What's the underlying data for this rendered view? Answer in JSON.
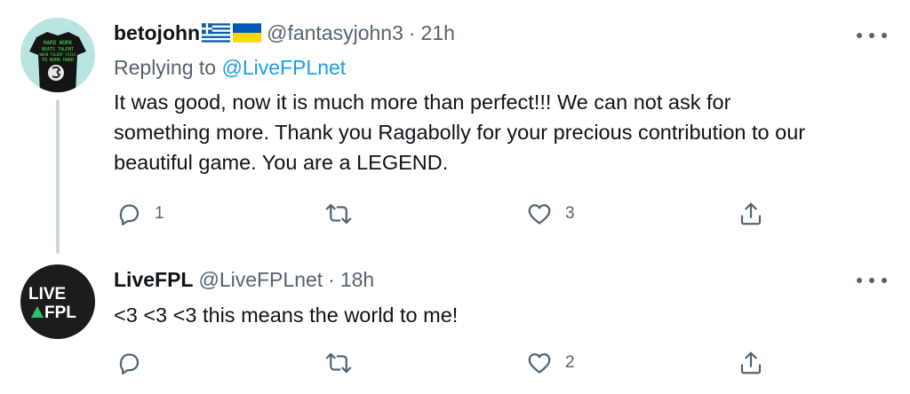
{
  "tweets": [
    {
      "display_name": "betojohn",
      "handle": "@fantasyjohn3",
      "separator": "·",
      "time": "21h",
      "replying_prefix": "Replying to",
      "replying_to": "@LiveFPLnet",
      "text_lines": [
        "It was good, now it is much more than perfect!!! We can not ask for",
        "something more. Thank you Ragabolly for your precious contribution to our",
        "beautiful game. You are a LEGEND."
      ],
      "counts": {
        "reply": "1",
        "retweet": "",
        "like": "3"
      },
      "avatar_shirt_text": [
        "HARD WORK",
        "BEATS TALENT",
        "WHEN TALENT FAILS",
        "TO WORK HARD"
      ],
      "flags": [
        "greece-flag",
        "ukraine-flag"
      ]
    },
    {
      "display_name": "LiveFPL",
      "handle": "@LiveFPLnet",
      "separator": "·",
      "time": "18h",
      "text_lines": [
        "<3 <3 <3 this means the world to me!"
      ],
      "counts": {
        "reply": "",
        "retweet": "",
        "like": "2"
      },
      "avatar_logo": {
        "line1": "LIVE",
        "line2": "FPL"
      }
    }
  ],
  "colors": {
    "text_primary": "#0f1419",
    "text_secondary": "#536471",
    "link_blue": "#1d9bf0",
    "thread_line": "#cfd9de",
    "avatar_logo_green": "#2fbf71"
  },
  "icons": [
    "reply-icon",
    "retweet-icon",
    "like-icon",
    "share-icon",
    "more-icon"
  ]
}
